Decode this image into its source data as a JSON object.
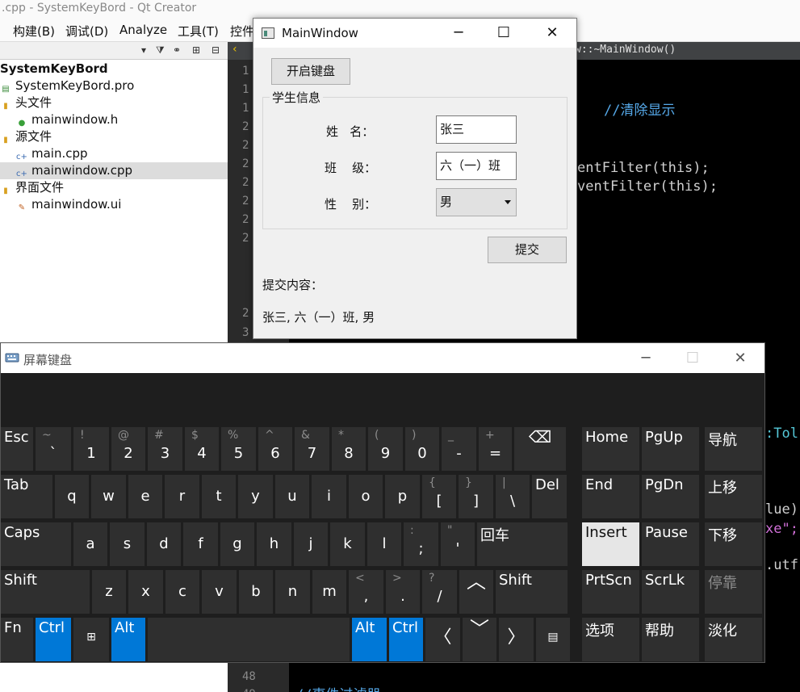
{
  "qtcreator": {
    "title": ".cpp - SystemKeyBord - Qt Creator",
    "menu": [
      "构建(B)",
      "调试(D)",
      "Analyze",
      "工具(T)",
      "控件"
    ],
    "tree": {
      "project": "SystemKeyBord",
      "items": [
        {
          "label": "SystemKeyBord.pro"
        },
        {
          "label": "头文件"
        },
        {
          "label": "mainwindow.h"
        },
        {
          "label": "源文件"
        },
        {
          "label": "main.cpp"
        },
        {
          "label": "mainwindow.cpp"
        },
        {
          "label": "界面文件"
        },
        {
          "label": "mainwindow.ui"
        }
      ]
    },
    "editor": {
      "tab_label": "w::~MainWindow()",
      "line_numbers": [
        "1",
        "1",
        "1",
        "2",
        "2",
        "2",
        "2",
        "2",
        "2",
        "2",
        "2",
        "3",
        "48",
        "49"
      ],
      "code_lines": [
        "//清除显示",
        "entFilter(this);",
        "ventFilter(this);",
        ":Tol",
        "lue)",
        "xe\";",
        ".utf",
        "//事件过滤器"
      ]
    }
  },
  "mainwindow": {
    "title": "MainWindow",
    "open_keyboard_button": "开启键盘",
    "group_title": "学生信息",
    "name_label": "姓   名：",
    "name_value": "张三",
    "class_label": "班    级：",
    "class_value": "六（一）班",
    "gender_label": "性    别：",
    "gender_value": "男",
    "submit_button": "提交",
    "submit_content_label": "提交内容：",
    "submit_content_value": "张三, 六（一）班, 男"
  },
  "keyboard": {
    "title": "屏幕键盘",
    "row1": [
      {
        "main": "Esc"
      },
      {
        "sub": "~",
        "main": "`"
      },
      {
        "sub": "!",
        "main": "1"
      },
      {
        "sub": "@",
        "main": "2"
      },
      {
        "sub": "#",
        "main": "3"
      },
      {
        "sub": "$",
        "main": "4"
      },
      {
        "sub": "%",
        "main": "5"
      },
      {
        "sub": "^",
        "main": "6"
      },
      {
        "sub": "&",
        "main": "7"
      },
      {
        "sub": "*",
        "main": "8"
      },
      {
        "sub": "(",
        "main": "9"
      },
      {
        "sub": ")",
        "main": "0"
      },
      {
        "sub": "_",
        "main": "-"
      },
      {
        "sub": "+",
        "main": "="
      },
      {
        "main": "⌫"
      }
    ],
    "row2": [
      {
        "main": "Tab"
      },
      {
        "main": "q"
      },
      {
        "main": "w"
      },
      {
        "main": "e"
      },
      {
        "main": "r"
      },
      {
        "main": "t"
      },
      {
        "main": "y"
      },
      {
        "main": "u"
      },
      {
        "main": "i"
      },
      {
        "main": "o"
      },
      {
        "main": "p"
      },
      {
        "sub": "{",
        "main": "["
      },
      {
        "sub": "}",
        "main": "]"
      },
      {
        "sub": "|",
        "main": "\\"
      },
      {
        "main": "Del"
      }
    ],
    "row3": [
      {
        "main": "Caps"
      },
      {
        "main": "a"
      },
      {
        "main": "s"
      },
      {
        "main": "d"
      },
      {
        "main": "f"
      },
      {
        "main": "g"
      },
      {
        "main": "h"
      },
      {
        "main": "j"
      },
      {
        "main": "k"
      },
      {
        "main": "l"
      },
      {
        "sub": ":",
        "main": ";"
      },
      {
        "sub": "\"",
        "main": "'"
      },
      {
        "main": "回车"
      }
    ],
    "row4": [
      {
        "main": "Shift"
      },
      {
        "main": "z"
      },
      {
        "main": "x"
      },
      {
        "main": "c"
      },
      {
        "main": "v"
      },
      {
        "main": "b"
      },
      {
        "main": "n"
      },
      {
        "main": "m"
      },
      {
        "sub": "<",
        "main": ","
      },
      {
        "sub": ">",
        "main": "."
      },
      {
        "sub": "?",
        "main": "/"
      },
      {
        "main": "︿"
      },
      {
        "main": "Shift"
      }
    ],
    "row5": [
      {
        "main": "Fn"
      },
      {
        "main": "Ctrl"
      },
      {
        "main": "⊞"
      },
      {
        "main": "Alt"
      },
      {
        "main": ""
      },
      {
        "main": "Alt"
      },
      {
        "main": "Ctrl"
      },
      {
        "main": "〈"
      },
      {
        "main": "﹀"
      },
      {
        "main": "〉"
      },
      {
        "main": "▤"
      }
    ],
    "nav": [
      [
        "Home",
        "PgUp",
        "导航"
      ],
      [
        "End",
        "PgDn",
        "上移"
      ],
      [
        "Insert",
        "Pause",
        "下移"
      ],
      [
        "PrtScn",
        "ScrLk",
        "停靠"
      ],
      [
        "选项",
        "帮助",
        "淡化"
      ]
    ],
    "colors": {
      "key": "#2f2f2f",
      "accent": "#0078d7",
      "active": "#e6e6e6"
    }
  }
}
